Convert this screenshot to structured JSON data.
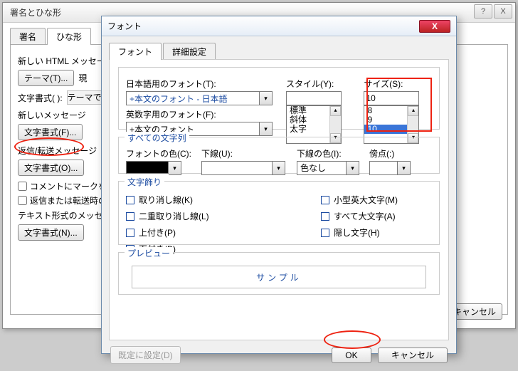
{
  "back": {
    "title": "署名とひな形",
    "tabs": {
      "sig": "署名",
      "stationery": "ひな形"
    },
    "lines": {
      "new_html_msg": "新しい HTML メッセージで",
      "new_msg": "新しいメッセージ",
      "reply_fwd": "返信/転送メッセージ",
      "text_format_msg": "テキスト形式のメッセージの"
    },
    "buttons": {
      "theme": "テーマ(T)...",
      "fontfmt_f": "文字書式(F)...",
      "fontfmt_o": "文字書式(O)...",
      "fontfmt_n": "文字書式(N)...",
      "cancel": "キャンセル"
    },
    "status": {
      "current": "現",
      "theme_disabled": "テーマで"
    },
    "prefix": "文字書式( ):",
    "cb": {
      "mark_comment": "コメントにマークを付",
      "repeat_header": "返信または転送時の"
    }
  },
  "front": {
    "title": "フォント",
    "tabs": {
      "font": "フォント",
      "advanced": "詳細設定"
    },
    "labels": {
      "jp_font": "日本語用のフォント(T):",
      "en_font": "英数字用のフォント(F):",
      "style": "スタイル(Y):",
      "size": "サイズ(S):",
      "all_chars": "すべての文字列",
      "font_color": "フォントの色(C):",
      "underline": "下線(U):",
      "underline_color": "下線の色(I):",
      "emphasis": "傍点(:)",
      "decoration": "文字飾り",
      "preview": "プレビュー"
    },
    "values": {
      "jp_font": "+本文のフォント - 日本語",
      "en_font": "+本文のフォント",
      "style_input": "",
      "size_input": "10",
      "underline_color_val": "色なし"
    },
    "style_options": [
      "標準",
      "斜体",
      "太字"
    ],
    "size_options": [
      "8",
      "9",
      "10"
    ],
    "decorations": {
      "strike": "取り消し線(K)",
      "dstrike": "二重取り消し線(L)",
      "super": "上付き(P)",
      "sub": "下付き(B)",
      "smallcaps": "小型英大文字(M)",
      "allcaps": "すべて大文字(A)",
      "hidden": "隠し文字(H)"
    },
    "preview_text": "サンプル",
    "footer": {
      "default": "既定に設定(D)",
      "ok": "OK",
      "cancel": "キャンセル"
    }
  }
}
